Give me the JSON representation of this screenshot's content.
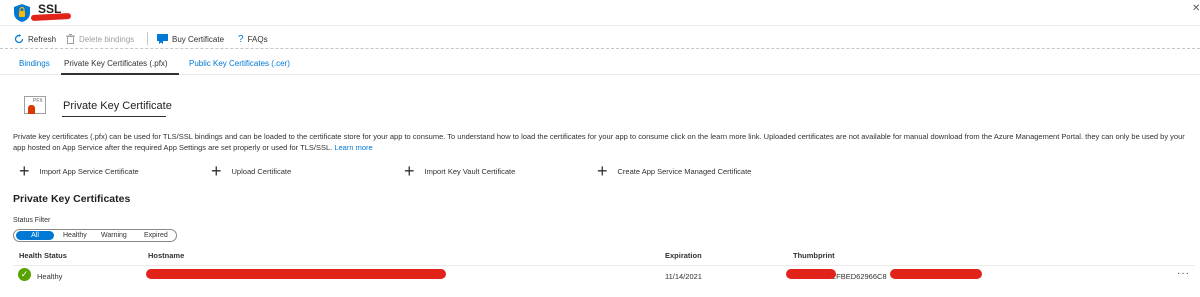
{
  "header": {
    "title": "SSL",
    "close_icon": "close-icon"
  },
  "toolbar": {
    "refresh_label": "Refresh",
    "delete_label": "Delete bindings",
    "buy_label": "Buy Certificate",
    "faqs_label": "FAQs"
  },
  "tabs": [
    {
      "label": "Bindings",
      "active": false
    },
    {
      "label": "Private Key Certificates (.pfx)",
      "active": true
    },
    {
      "label": "Public Key Certificates (.cer)",
      "active": false
    }
  ],
  "section": {
    "icon_label": "PFX",
    "title": "Private Key Certificate",
    "description": "Private key certificates (.pfx) can be used for TLS/SSL bindings and can be loaded to the certificate store for your app to consume. To understand how to load the certificates for your app to consume click on the learn more link. Uploaded certificates are not available for manual download from the Azure Management Portal. they can only be used by your app hosted on App Service after the required App Settings are set properly or used for TLS/SSL.",
    "learn_more": "Learn more"
  },
  "actions": [
    {
      "label": "Import App Service Certificate"
    },
    {
      "label": "Upload Certificate"
    },
    {
      "label": "Import Key Vault Certificate"
    },
    {
      "label": "Create App Service Managed Certificate"
    }
  ],
  "certificates": {
    "heading": "Private Key Certificates",
    "filter_label": "Status Filter",
    "filter_options": [
      "All",
      "Healthy",
      "Warning",
      "Expired"
    ],
    "filter_selected": "All",
    "columns": [
      "Health Status",
      "Hostname",
      "Expiration",
      "Thumbprint"
    ],
    "rows": [
      {
        "health_status": "Healthy",
        "expiration": "11/14/2021",
        "thumbprint_visible": "2FBED62966C8",
        "more": "···"
      }
    ]
  },
  "colors": {
    "accent": "#0078d4",
    "healthy": "#57a300",
    "redaction": "#e2231a"
  }
}
